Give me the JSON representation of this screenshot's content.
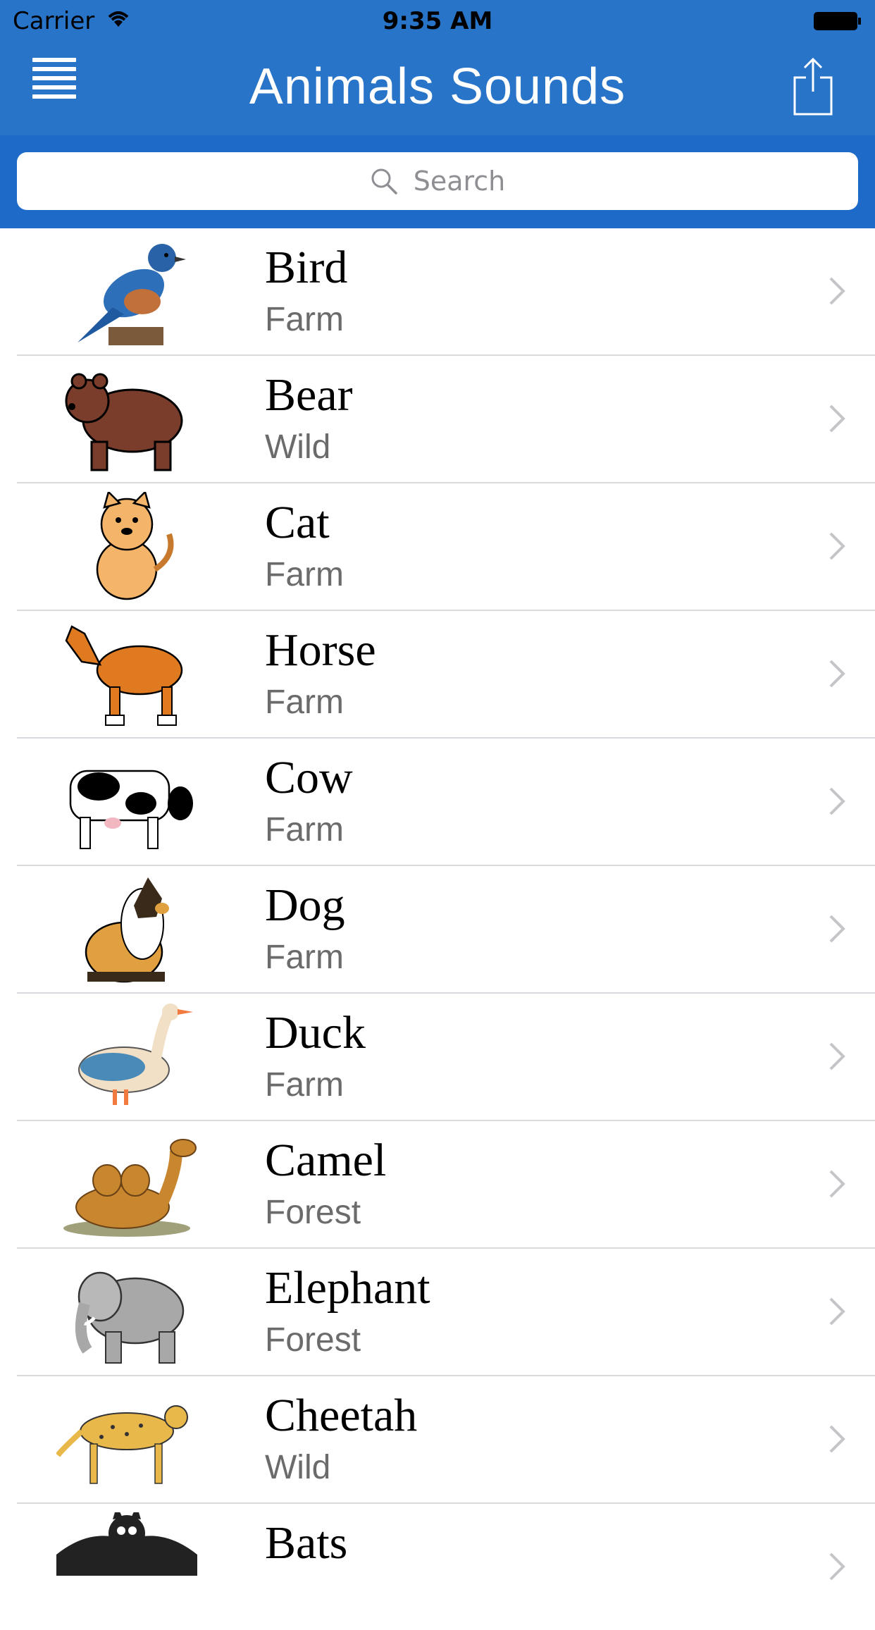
{
  "status": {
    "carrier": "Carrier",
    "time": "9:35 AM"
  },
  "nav": {
    "title": "Animals Sounds"
  },
  "search": {
    "placeholder": "Search"
  },
  "colors": {
    "primary": "#2874c8",
    "search_bg": "#1d6ac8"
  },
  "animals": [
    {
      "name": "Bird",
      "category": "Farm",
      "icon": "bird-image"
    },
    {
      "name": "Bear",
      "category": "Wild",
      "icon": "bear-image"
    },
    {
      "name": "Cat",
      "category": "Farm",
      "icon": "cat-image"
    },
    {
      "name": "Horse",
      "category": "Farm",
      "icon": "horse-image"
    },
    {
      "name": "Cow",
      "category": "Farm",
      "icon": "cow-image"
    },
    {
      "name": "Dog",
      "category": "Farm",
      "icon": "dog-image"
    },
    {
      "name": "Duck",
      "category": "Farm",
      "icon": "duck-image"
    },
    {
      "name": "Camel",
      "category": "Forest",
      "icon": "camel-image"
    },
    {
      "name": "Elephant",
      "category": "Forest",
      "icon": "elephant-image"
    },
    {
      "name": "Cheetah",
      "category": "Wild",
      "icon": "cheetah-image"
    },
    {
      "name": "Bats",
      "category": "",
      "icon": "bat-image"
    }
  ]
}
